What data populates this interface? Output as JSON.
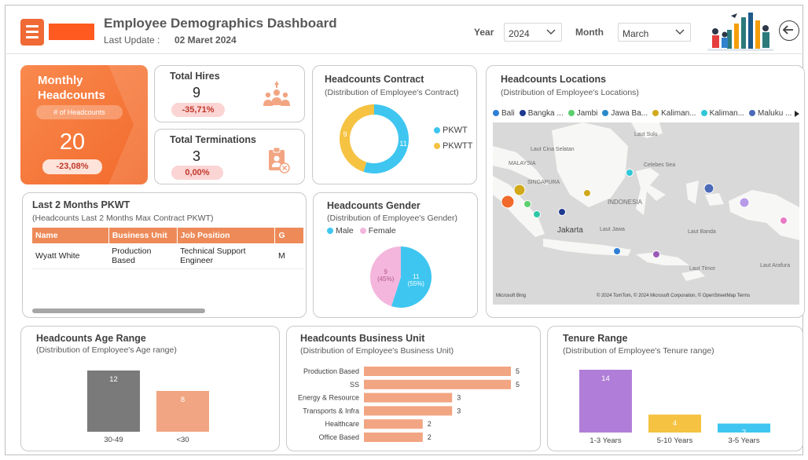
{
  "header": {
    "title": "Employee Demographics Dashboard",
    "last_update_label": "Last Update :",
    "last_update_value": "02 Maret 2024",
    "year_label": "Year",
    "year_value": "2024",
    "month_label": "Month",
    "month_value": "March"
  },
  "kpi": {
    "monthly": {
      "title": "Monthly Headcounts",
      "subtitle": "# of Headcounts",
      "value": "20",
      "change": "-23,08%"
    },
    "hires": {
      "title": "Total Hires",
      "value": "9",
      "change": "-35,71%"
    },
    "terminations": {
      "title": "Total Terminations",
      "value": "3",
      "change": "0,00%"
    }
  },
  "contract": {
    "title": "Headcounts Contract",
    "subtitle": "(Distribution of Employee's Contract)",
    "legend": [
      {
        "name": "PKWT",
        "color": "#3ec6f0"
      },
      {
        "name": "PKWTT",
        "color": "#f5c242"
      }
    ],
    "chart_data": {
      "type": "pie",
      "categories": [
        "PKWT",
        "PKWTT"
      ],
      "values": [
        11,
        9
      ],
      "donut": true,
      "colors": [
        "#3ec6f0",
        "#f5c242"
      ]
    }
  },
  "locations": {
    "title": "Headcounts Locations",
    "subtitle": "(Distribution of Employee's Locations)",
    "legend": [
      {
        "name": "Bali",
        "color": "#2f7fd6"
      },
      {
        "name": "Bangka ...",
        "color": "#1f3a8f"
      },
      {
        "name": "Jambi",
        "color": "#5ccf6e"
      },
      {
        "name": "Jawa Ba...",
        "color": "#2a89c9"
      },
      {
        "name": "Kaliman...",
        "color": "#d1a91a"
      },
      {
        "name": "Kaliman...",
        "color": "#2fc7d8"
      },
      {
        "name": "Maluku ...",
        "color": "#4b6bb8"
      }
    ],
    "map_labels": [
      "Laut Sulu",
      "Laut Cina Selatan",
      "MALAYSIA",
      "SINGAPURA",
      "Celebes Sea",
      "INDONESIA",
      "Jakarta",
      "Laut Jawa",
      "Laut Banda",
      "Laut Timor",
      "Laut Arafura"
    ],
    "attribution": "© 2024 TomTom, © 2024 Microsoft Corporation, © OpenStreetMap  Terms",
    "provider": "Microsoft Bing"
  },
  "pkwt": {
    "title": "Last 2 Months PKWT",
    "subtitle": "(Headcounts Last 2 Months Max Contract PKWT)",
    "columns": [
      "Name",
      "Business Unit",
      "Job Position",
      "G"
    ],
    "rows": [
      [
        "Wyatt White",
        "Production Based",
        "Technical Support Engineer",
        "M"
      ]
    ]
  },
  "gender": {
    "title": "Headcounts Gender",
    "subtitle": "(Distribution of Employee's Gender)",
    "legend": [
      {
        "name": "Male",
        "color": "#3ec6f0"
      },
      {
        "name": "Female",
        "color": "#f4b6dc"
      }
    ],
    "chart_data": {
      "type": "pie",
      "categories": [
        "Male",
        "Female"
      ],
      "values": [
        11,
        9
      ],
      "labels": [
        "11 (55%)",
        "9 (45%)"
      ],
      "colors": [
        "#3ec6f0",
        "#f4b6dc"
      ]
    }
  },
  "age": {
    "title": "Headcounts Age Range",
    "subtitle": "(Distribution of Employee's Age range)",
    "chart_data": {
      "type": "bar",
      "categories": [
        "30-49",
        "<30"
      ],
      "values": [
        12,
        8
      ],
      "colors": [
        "#7a7a7a",
        "#f2a582"
      ]
    }
  },
  "business_unit": {
    "title": "Headcounts Business Unit",
    "subtitle": "(Distribution of Employee's Business Unit)",
    "chart_data": {
      "type": "bar",
      "orientation": "horizontal",
      "categories": [
        "Production Based",
        "SS",
        "Energy & Resource",
        "Transports & Infra",
        "Healthcare",
        "Office Based"
      ],
      "values": [
        5,
        5,
        3,
        3,
        2,
        2
      ],
      "color": "#f2a582"
    }
  },
  "tenure": {
    "title": "Tenure Range",
    "subtitle": "(Distribution of Employee's Tenure range)",
    "chart_data": {
      "type": "bar",
      "categories": [
        "1-3 Years",
        "5-10 Years",
        "3-5 Years"
      ],
      "values": [
        14,
        4,
        2
      ],
      "colors": [
        "#b07ed8",
        "#f5c242",
        "#3ec6f0"
      ]
    }
  }
}
